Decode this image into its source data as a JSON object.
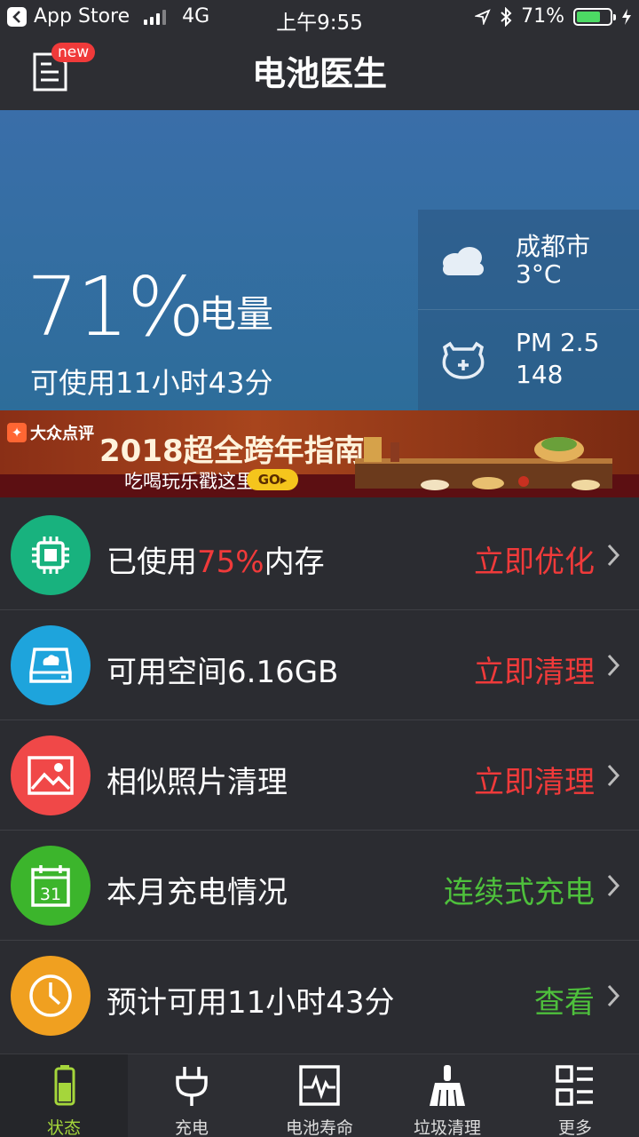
{
  "status_bar": {
    "back_app": "App Store",
    "network": "4G",
    "time": "上午9:55",
    "battery_text": "71%",
    "battery_level": 0.71
  },
  "nav": {
    "title": "电池医生",
    "badge": "new"
  },
  "hero": {
    "percent": "71%",
    "percent_label": "电量",
    "remaining": "可使用11小时43分",
    "weather": {
      "city": "成都市",
      "temp": "3°C",
      "icon": "cloud-icon"
    },
    "air": {
      "label": "PM 2.5",
      "value": "148",
      "icon": "pollution-mask-icon"
    }
  },
  "banner": {
    "brand": "大众点评",
    "title": "2018超全跨年指南",
    "subtitle": "吃喝玩乐戳这里",
    "go": "GO▸"
  },
  "rows": [
    {
      "label_pre": "已使用",
      "label_hl": "75%",
      "label_post": "内存",
      "action": "立即优化",
      "action_color": "#f03a3a",
      "icon": "chip-icon",
      "color": "#18b27e"
    },
    {
      "label_pre": "可用空间6.16GB",
      "label_hl": "",
      "label_post": "",
      "action": "立即清理",
      "action_color": "#f03a3a",
      "icon": "storage-cloud-icon",
      "color": "#1ea4dc"
    },
    {
      "label_pre": "相似照片清理",
      "label_hl": "",
      "label_post": "",
      "action": "立即清理",
      "action_color": "#f03a3a",
      "icon": "photo-icon",
      "color": "#f04848"
    },
    {
      "label_pre": "本月充电情况",
      "label_hl": "",
      "label_post": "",
      "action": "连续式充电",
      "action_color": "#4ec03c",
      "icon": "calendar-icon",
      "color": "#3cb52c"
    },
    {
      "label_pre": "预计可用11小时43分",
      "label_hl": "",
      "label_post": "",
      "action": "查看",
      "action_color": "#4ec03c",
      "icon": "clock-icon",
      "color": "#f0a020"
    }
  ],
  "tabs": [
    {
      "label": "状态",
      "icon": "battery-status-icon",
      "active": true
    },
    {
      "label": "充电",
      "icon": "plug-icon",
      "active": false
    },
    {
      "label": "电池寿命",
      "icon": "heartbeat-monitor-icon",
      "active": false
    },
    {
      "label": "垃圾清理",
      "icon": "broom-icon",
      "active": false
    },
    {
      "label": "更多",
      "icon": "grid-list-icon",
      "active": false
    }
  ],
  "colors": {
    "background": "#2b2c31",
    "hero_top": "#3a6ea9",
    "hero_bottom": "#2d6d9a",
    "accent_red": "#f03a3a",
    "accent_green": "#4ec03c",
    "tab_active": "#a5d63b"
  }
}
